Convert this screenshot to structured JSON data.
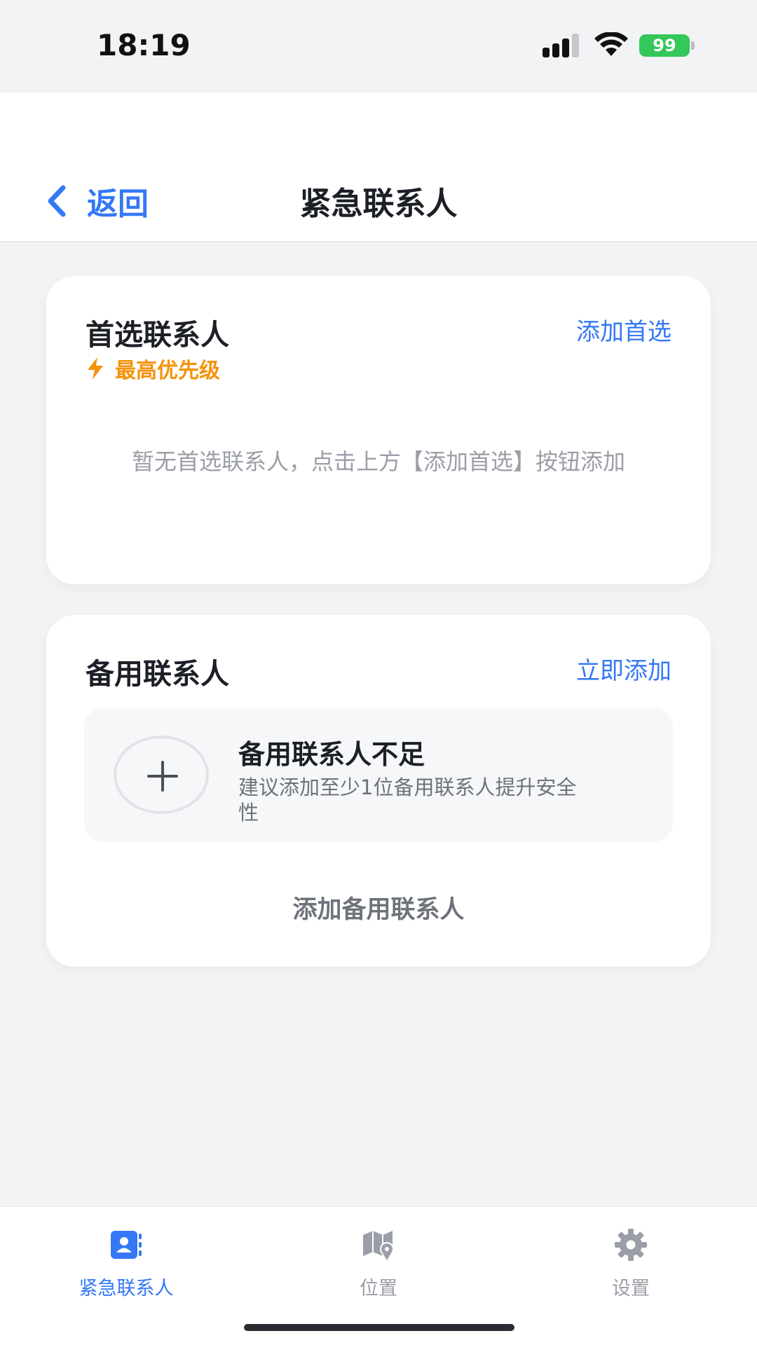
{
  "status_bar": {
    "time": "18:19",
    "battery_level": "99",
    "icons": [
      "signal-icon",
      "wifi-icon",
      "battery-icon"
    ]
  },
  "nav": {
    "back_label": "返回",
    "title": "紧急联系人"
  },
  "primary_card": {
    "title": "首选联系人",
    "action": "添加首选",
    "priority_label": "最高优先级",
    "empty_text": "暂无首选联系人，点击上方【添加首选】按钮添加"
  },
  "backup_card": {
    "title": "备用联系人",
    "action": "立即添加",
    "warning_title": "备用联系人不足",
    "warning_desc": "建议添加至少1位备用联系人提升安全性",
    "add_link": "添加备用联系人"
  },
  "tabs": [
    {
      "label": "紧急联系人",
      "icon": "contacts-icon",
      "active": true
    },
    {
      "label": "位置",
      "icon": "map-pin-icon",
      "active": false
    },
    {
      "label": "设置",
      "icon": "gear-icon",
      "active": false
    }
  ],
  "colors": {
    "accent": "#3478f6",
    "warning": "#f5930b",
    "battery": "#34c759",
    "background": "#f2f3f5"
  }
}
